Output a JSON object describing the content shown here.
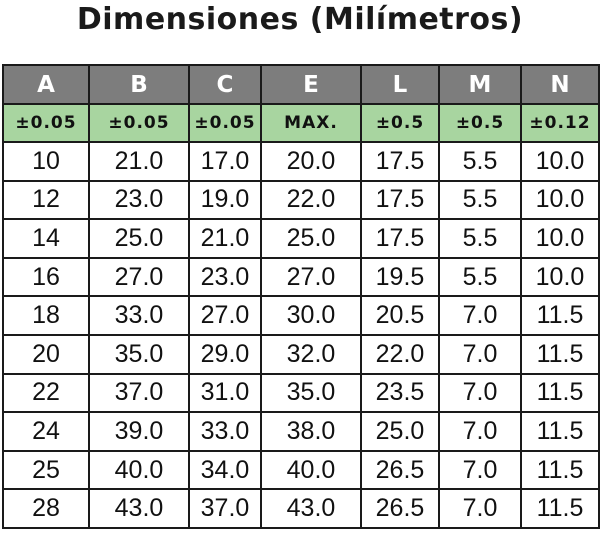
{
  "title": "Dimensiones (Milímetros)",
  "colors": {
    "header_bg": "#7d7d7d",
    "tolerance_bg": "#a8d5a0"
  },
  "columns": [
    "A",
    "B",
    "C",
    "E",
    "L",
    "M",
    "N"
  ],
  "tolerances": [
    "±0.05",
    "±0.05",
    "±0.05",
    "MAX.",
    "±0.5",
    "±0.5",
    "±0.12"
  ],
  "rows": [
    [
      "10",
      "21.0",
      "17.0",
      "20.0",
      "17.5",
      "5.5",
      "10.0"
    ],
    [
      "12",
      "23.0",
      "19.0",
      "22.0",
      "17.5",
      "5.5",
      "10.0"
    ],
    [
      "14",
      "25.0",
      "21.0",
      "25.0",
      "17.5",
      "5.5",
      "10.0"
    ],
    [
      "16",
      "27.0",
      "23.0",
      "27.0",
      "19.5",
      "5.5",
      "10.0"
    ],
    [
      "18",
      "33.0",
      "27.0",
      "30.0",
      "20.5",
      "7.0",
      "11.5"
    ],
    [
      "20",
      "35.0",
      "29.0",
      "32.0",
      "22.0",
      "7.0",
      "11.5"
    ],
    [
      "22",
      "37.0",
      "31.0",
      "35.0",
      "23.5",
      "7.0",
      "11.5"
    ],
    [
      "24",
      "39.0",
      "33.0",
      "38.0",
      "25.0",
      "7.0",
      "11.5"
    ],
    [
      "25",
      "40.0",
      "34.0",
      "40.0",
      "26.5",
      "7.0",
      "11.5"
    ],
    [
      "28",
      "43.0",
      "37.0",
      "43.0",
      "26.5",
      "7.0",
      "11.5"
    ]
  ]
}
